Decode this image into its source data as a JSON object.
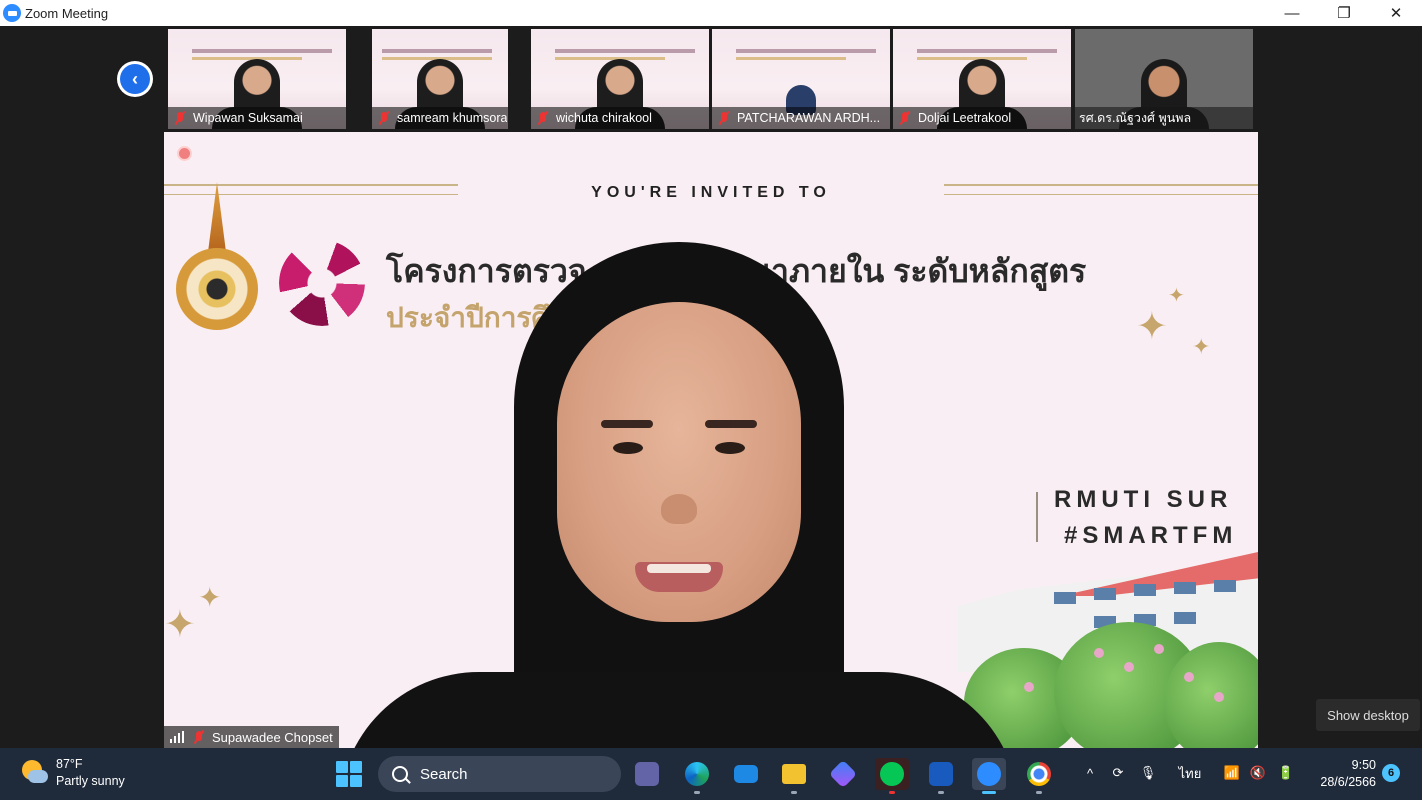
{
  "window": {
    "title": "Zoom Meeting",
    "minimize_glyph": "—",
    "maximize_glyph": "❐",
    "close_glyph": "✕"
  },
  "meeting": {
    "back_glyph": "‹",
    "participants": [
      {
        "name": "Wipawan Suksamai",
        "muted": true
      },
      {
        "name": "samream khumsora",
        "muted": true
      },
      {
        "name": "wichuta chirakool",
        "muted": true
      },
      {
        "name": "PATCHARAWAN ARDH...",
        "muted": true
      },
      {
        "name": "Doljai Leetrakool",
        "muted": true
      },
      {
        "name": "รศ.ดร.ณัฐวงศ์ พูนพล",
        "muted": false
      }
    ],
    "presenter": {
      "name": "Supawadee Chopset",
      "muted": true
    },
    "slide": {
      "heading": "YOU'RE INVITED TO",
      "thai_line1": "โครงการตรวจ                  ภาพการศึกษาภายใน ระดับหลักสูตร",
      "thai_line2": "ประจำปีการศึ                   ทคโนโลยีการจัดการ",
      "rmuti": "RMUTI SUR",
      "hashtag": "#SMARTFM"
    },
    "show_desktop": "Show desktop"
  },
  "taskbar": {
    "weather_temp": "87°F",
    "weather_desc": "Partly sunny",
    "search_label": "Search",
    "language": "ไทย",
    "time": "9:50",
    "date": "28/6/2566",
    "notification_count": "6"
  },
  "icons": {
    "app": "zoom-icon",
    "weather": "partly-sunny-icon",
    "start": "windows-start-icon",
    "search": "search-icon"
  },
  "colors": {
    "zoom_blue": "#2d8cff",
    "mute_red": "#e33333",
    "slide_bg": "#f9eef3",
    "gold": "#c4a46c",
    "taskbar": "#1f2a3a",
    "accent": "#4cc2ff"
  }
}
